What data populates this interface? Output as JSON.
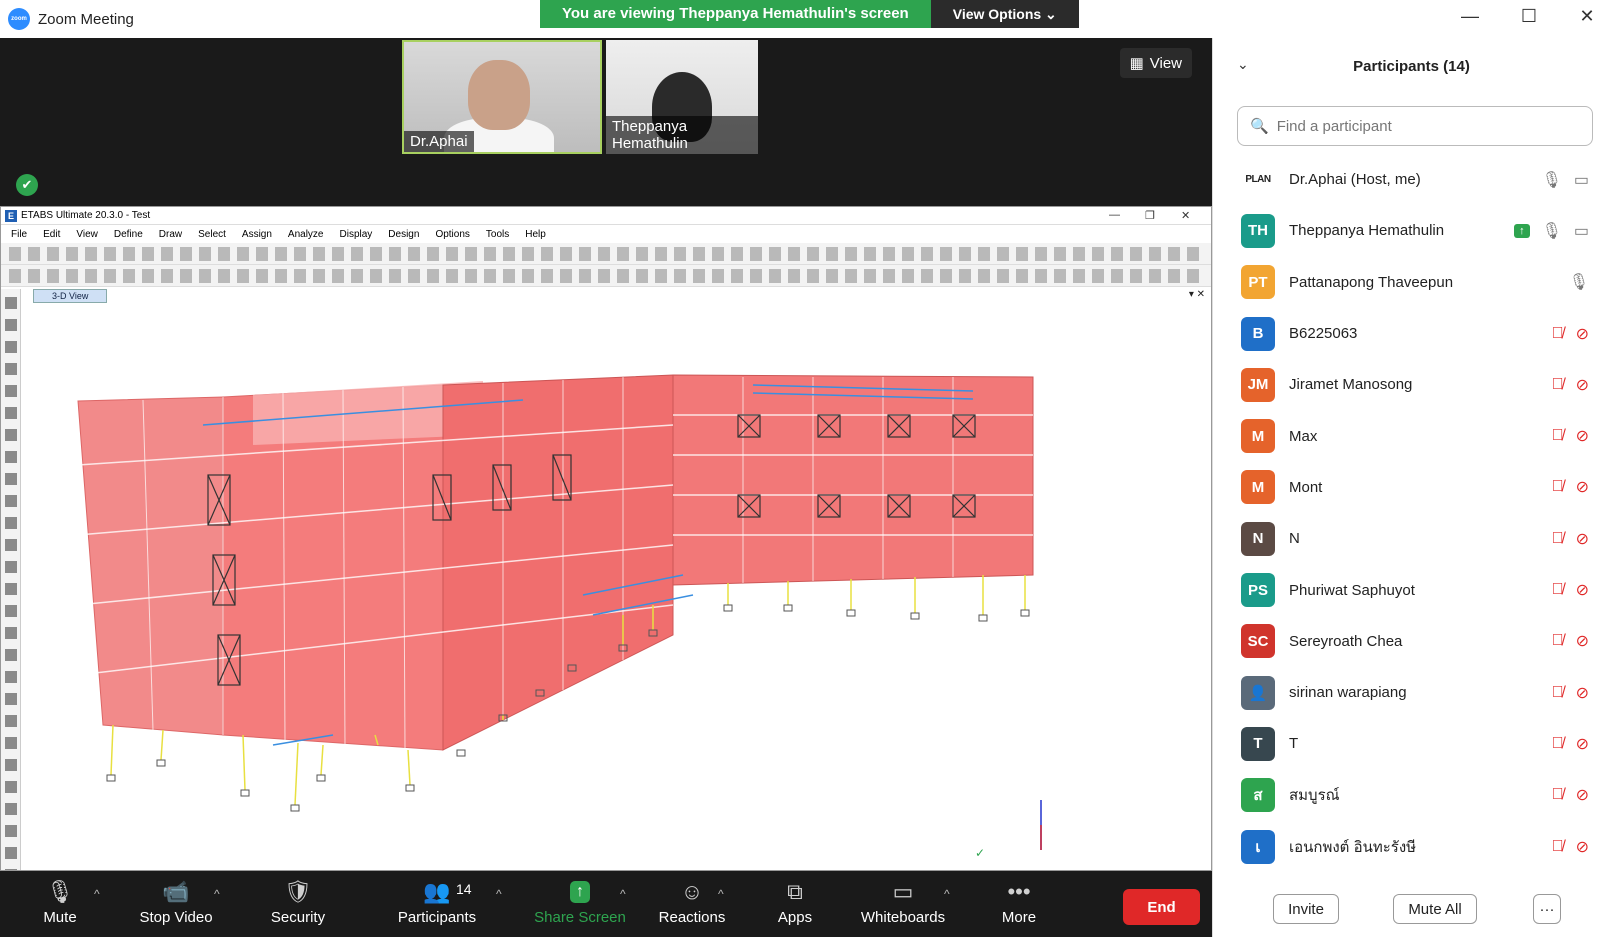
{
  "window": {
    "title": "Zoom Meeting",
    "logo_text": "zoom",
    "controls": [
      "—",
      "☐",
      "✕"
    ]
  },
  "share_banner": {
    "text": "You are viewing Theppanya Hemathulin's screen",
    "view_options": "View Options ⌄"
  },
  "videos": [
    {
      "name": "Dr.Aphai"
    },
    {
      "name": "Theppanya Hemathulin"
    }
  ],
  "view_button": "View",
  "etabs": {
    "title": "ETABS Ultimate 20.3.0 - Test",
    "menu": [
      "File",
      "Edit",
      "View",
      "Define",
      "Draw",
      "Select",
      "Assign",
      "Analyze",
      "Display",
      "Design",
      "Options",
      "Tools",
      "Help"
    ],
    "view_tab": "3-D View"
  },
  "controls": {
    "mute": "Mute",
    "stop_video": "Stop Video",
    "security": "Security",
    "participants": "Participants",
    "participants_count": "14",
    "share_screen": "Share Screen",
    "reactions": "Reactions",
    "apps": "Apps",
    "whiteboards": "Whiteboards",
    "more": "More",
    "end": "End"
  },
  "panel": {
    "title": "Participants (14)",
    "search_placeholder": "Find a participant",
    "participants": [
      {
        "initials": "PLAN",
        "name": "Dr.Aphai (Host, me)",
        "color": "#ffffff",
        "mic": "on",
        "cam": "on",
        "logo": true
      },
      {
        "initials": "TH",
        "name": "Theppanya Hemathulin",
        "color": "#1a9b8a",
        "mic": "on",
        "cam": "on",
        "sharing": true
      },
      {
        "initials": "PT",
        "name": "Pattanapong Thaveepun",
        "color": "#f2a532",
        "mic": "on",
        "cam": "none"
      },
      {
        "initials": "B",
        "name": "B6225063",
        "color": "#1f6fc8",
        "mic": "muted",
        "cam": "off"
      },
      {
        "initials": "JM",
        "name": "Jiramet Manosong",
        "color": "#e5632b",
        "mic": "muted",
        "cam": "off"
      },
      {
        "initials": "M",
        "name": "Max",
        "color": "#e5632b",
        "mic": "muted",
        "cam": "off"
      },
      {
        "initials": "M",
        "name": "Mont",
        "color": "#e5632b",
        "mic": "muted",
        "cam": "off"
      },
      {
        "initials": "N",
        "name": "N",
        "color": "#5b4a44",
        "mic": "muted",
        "cam": "off"
      },
      {
        "initials": "PS",
        "name": "Phuriwat Saphuyot",
        "color": "#1a9b8a",
        "mic": "muted",
        "cam": "off"
      },
      {
        "initials": "SC",
        "name": "Sereyroath Chea",
        "color": "#d0342c",
        "mic": "muted",
        "cam": "off"
      },
      {
        "initials": "👤",
        "name": "sirinan warapiang",
        "color": "#5a6a7a",
        "mic": "muted",
        "cam": "off"
      },
      {
        "initials": "T",
        "name": "T",
        "color": "#37474f",
        "mic": "muted",
        "cam": "off"
      },
      {
        "initials": "ส",
        "name": "สมบูรณ์",
        "color": "#2ea44f",
        "mic": "muted",
        "cam": "off"
      },
      {
        "initials": "เ",
        "name": "เอนกพงต์ อินทะรังษี",
        "color": "#1f6fc8",
        "mic": "muted",
        "cam": "off"
      }
    ],
    "invite": "Invite",
    "mute_all": "Mute All",
    "more": "···"
  }
}
